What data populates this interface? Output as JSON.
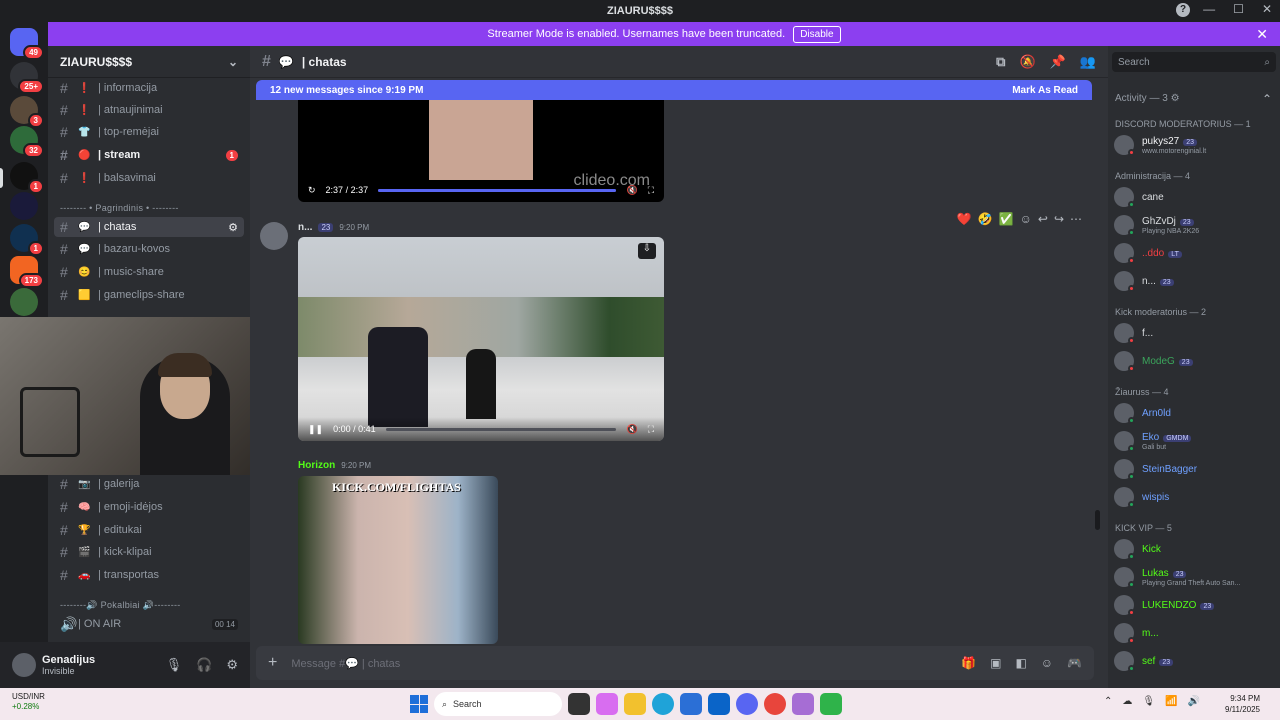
{
  "window": {
    "title": "ZIAURU$$$$"
  },
  "banner": {
    "text": "Streamer Mode is enabled. Usernames have been truncated.",
    "button": "Disable"
  },
  "server_badges": [
    "49",
    "25+",
    "3",
    "32",
    "1",
    "1",
    "173"
  ],
  "server": {
    "name": "ZIAURU$$$$"
  },
  "channels": [
    {
      "name": "| informacija",
      "emoji": "❗"
    },
    {
      "name": "| atnaujinimai",
      "emoji": "❗"
    },
    {
      "name": "| top-remėjai",
      "emoji": "👕"
    },
    {
      "name": "| stream",
      "emoji": "🔴",
      "badge": "1"
    },
    {
      "name": "| balsavimai",
      "emoji": "❗"
    }
  ],
  "category_pagrindinis": "-------- • Pagrindinis • --------",
  "channels2": [
    {
      "name": "| chatas",
      "emoji": "💬"
    },
    {
      "name": "| bazaru-kovos",
      "emoji": "💬"
    },
    {
      "name": "| music-share",
      "emoji": "😊"
    },
    {
      "name": "| gameclips-share",
      "emoji": "🟨"
    }
  ],
  "channels3": [
    {
      "name": "| galerija",
      "emoji": "📷"
    },
    {
      "name": "| emoji-idėjos",
      "emoji": "🧠"
    },
    {
      "name": "| editukai",
      "emoji": "🏆"
    },
    {
      "name": "| kick-klipai",
      "emoji": "🎬"
    },
    {
      "name": "| transportas",
      "emoji": "🚗"
    }
  ],
  "category_pokalbiai": "--------🔊 Pokalbiai 🔊--------",
  "voice": {
    "name": "| ON AIR",
    "count1": "00",
    "count2": "14"
  },
  "user": {
    "name": "Genadijus",
    "status": "Invisible"
  },
  "main": {
    "channel": "| chatas",
    "new_messages": "12 new messages since 9:19 PM",
    "mark_read": "Mark As Read",
    "video1_time": "2:37 / 2:37",
    "video1_watermark": "clideo.com",
    "video1_progress": 1.0,
    "msg1_author": "n...",
    "msg1_tag": "23",
    "msg1_time": "9:20 PM",
    "video2_time": "0:00 / 0:41",
    "video2_progress": 0.0,
    "msg2_author": "Horizon",
    "msg2_time": "9:20 PM",
    "image_caption": "KICK.COM/FLIGHTAS",
    "composer_placeholder": "Message #💬 | chatas"
  },
  "members": {
    "search": "Search",
    "activity": "Activity — 3",
    "sections": [
      {
        "title": "DISCORD MODERATORIUS — 1",
        "items": [
          {
            "name": "pukys27",
            "chip": "23",
            "sub": "www.motorenginial.lt",
            "color": "#f2f3f5",
            "status": "#f23f43"
          }
        ]
      },
      {
        "title": "Administracija — 4",
        "items": [
          {
            "name": "cane",
            "color": "#dbdee1",
            "status": "#23a55a"
          },
          {
            "name": "GhZvDj",
            "chip": "23",
            "sub": "Playing NBA 2K26",
            "color": "#dbdee1",
            "status": "#23a55a"
          },
          {
            "name": "..ddo",
            "chip": "LT",
            "color": "#f23f43",
            "status": "#f23f43"
          },
          {
            "name": "n...",
            "chip": "23",
            "color": "#dbdee1",
            "status": "#f23f43"
          }
        ]
      },
      {
        "title": "Kick moderatorius — 2",
        "items": [
          {
            "name": "f...",
            "color": "#dbdee1",
            "status": "#f23f43"
          },
          {
            "name": "ModeG",
            "chip": "23",
            "color": "#3ba55c",
            "status": "#f23f43"
          }
        ]
      },
      {
        "title": "Žiauruss — 4",
        "items": [
          {
            "name": "Arn0ld",
            "color": "#6fa0ff",
            "status": "#23a55a"
          },
          {
            "name": "Eko",
            "chip": "GMDM",
            "sub": "Gali but",
            "color": "#6fa0ff",
            "status": "#23a55a"
          },
          {
            "name": "SteinBagger",
            "color": "#6fa0ff",
            "status": "#23a55a"
          },
          {
            "name": "wispis",
            "color": "#6fa0ff",
            "status": "#23a55a"
          }
        ]
      },
      {
        "title": "KICK VIP — 5",
        "items": [
          {
            "name": "Kick",
            "color": "#53fc18",
            "status": "#23a55a"
          },
          {
            "name": "Lukas",
            "chip": "23",
            "sub": "Playing Grand Theft Auto San...",
            "color": "#53fc18",
            "status": "#23a55a"
          },
          {
            "name": "LUKENDZO",
            "chip": "23",
            "color": "#53fc18",
            "status": "#f23f43"
          },
          {
            "name": "m...",
            "color": "#53fc18",
            "status": "#f23f43"
          },
          {
            "name": "sef",
            "chip": "23",
            "color": "#53fc18",
            "status": "#23a55a"
          }
        ]
      }
    ]
  },
  "taskbar": {
    "stock_name": "USD/INR",
    "stock_change": "+0.28%",
    "search": "Search",
    "time": "9:34 PM",
    "date": "9/11/2025"
  }
}
